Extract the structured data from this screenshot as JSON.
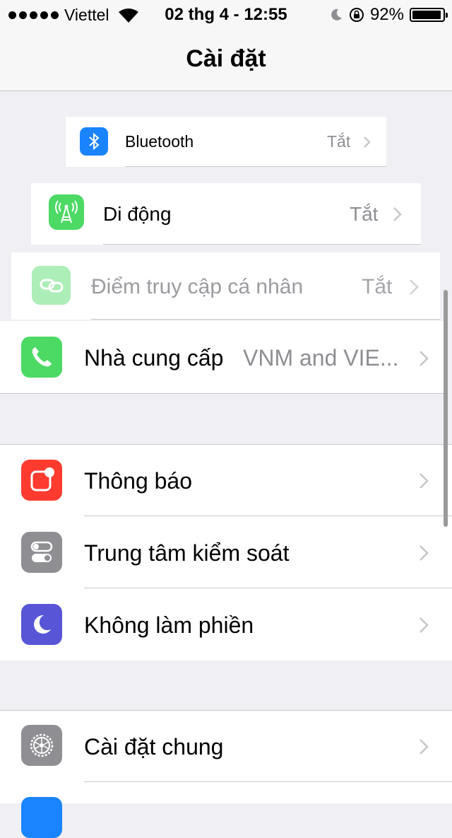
{
  "status_bar": {
    "carrier": "Viettel",
    "time": "02 thg 4 - 12:55",
    "battery": "92%",
    "battery_level": 0.92
  },
  "nav": {
    "title": "Cài đặt"
  },
  "rows": {
    "bluetooth": {
      "label": "Bluetooth",
      "value": "Tắt",
      "icon": "bluetooth-icon",
      "color": "#1a84ff"
    },
    "cellular": {
      "label": "Di động",
      "value": "Tắt",
      "icon": "cellular-antenna-icon",
      "color": "#4cd964"
    },
    "hotspot": {
      "label": "Điểm truy cập cá nhân",
      "value": "Tắt",
      "icon": "personal-hotspot-icon",
      "color": "#4cd964"
    },
    "carrier": {
      "label": "Nhà cung cấp",
      "value": "VNM and VIE...",
      "icon": "phone-icon",
      "color": "#4cd964"
    },
    "notifications": {
      "label": "Thông báo",
      "icon": "notifications-icon",
      "color": "#ff3b30"
    },
    "control_center": {
      "label": "Trung tâm kiểm soát",
      "icon": "control-center-icon",
      "color": "#8e8e93"
    },
    "do_not_disturb": {
      "label": "Không làm phiền",
      "icon": "moon-icon",
      "color": "#5856d6"
    },
    "general": {
      "label": "Cài đặt chung",
      "icon": "gear-icon",
      "color": "#8e8e93"
    }
  }
}
